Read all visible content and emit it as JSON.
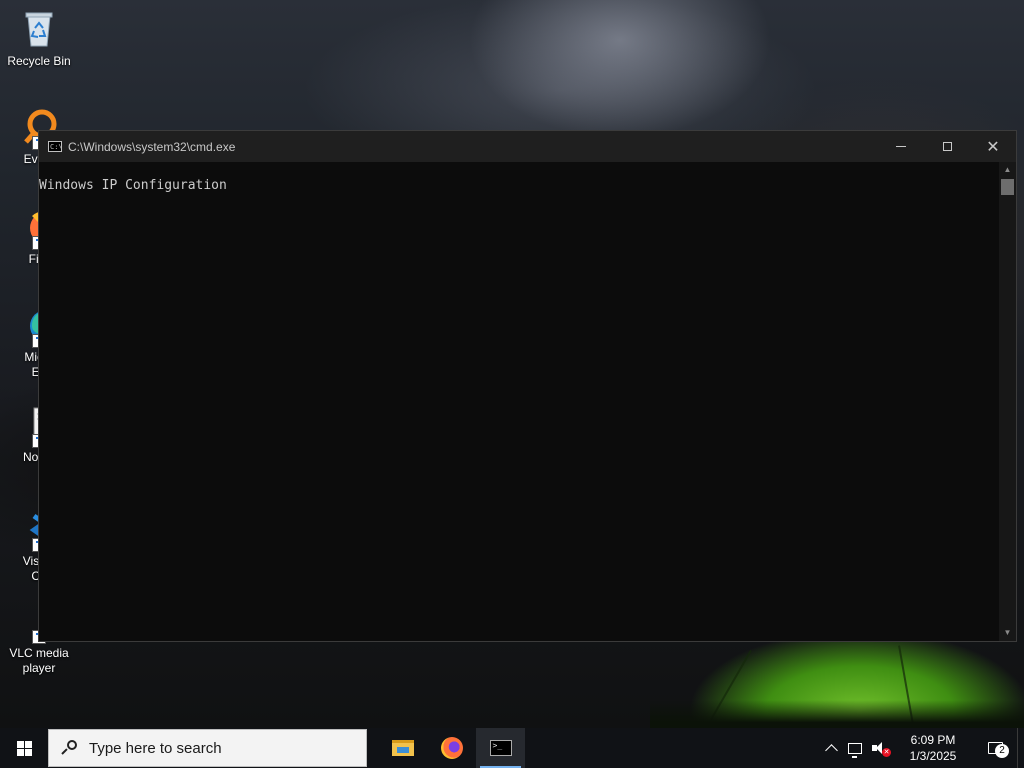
{
  "desktop": {
    "icons": [
      {
        "label_line1": "Recycle Bin",
        "label_line2": ""
      },
      {
        "label_line1": "Every",
        "label_line2": ""
      },
      {
        "label_line1": "Fire",
        "label_line2": ""
      },
      {
        "label_line1": "Micro",
        "label_line2": "Ed"
      },
      {
        "label_line1": "Notep",
        "label_line2": ""
      },
      {
        "label_line1": "Visual",
        "label_line2": "Co"
      },
      {
        "label_line1": "VLC media",
        "label_line2": "player"
      }
    ]
  },
  "cmd_window": {
    "title": "C:\\Windows\\system32\\cmd.exe",
    "icon_text": "C:\\",
    "lines": [
      "Windows IP Configuration"
    ],
    "controls": {
      "minimize": "minimize",
      "maximize": "maximize",
      "close": "✕"
    }
  },
  "taskbar": {
    "search_placeholder": "Type here to search",
    "apps": [
      {
        "name": "File Explorer",
        "icon": "folder-icon"
      },
      {
        "name": "Firefox",
        "icon": "firefox-icon"
      },
      {
        "name": "Command Prompt",
        "icon": "cmd-icon",
        "active": true
      }
    ],
    "tray": {
      "time": "6:09 PM",
      "date": "1/3/2025",
      "notification_count": "2"
    },
    "cmd_icon_text": ">_"
  },
  "colors": {
    "taskbar_bg": "#101216",
    "console_bg": "#0c0c0c",
    "console_text": "#cccccc",
    "active_indicator": "#75b2f0"
  }
}
